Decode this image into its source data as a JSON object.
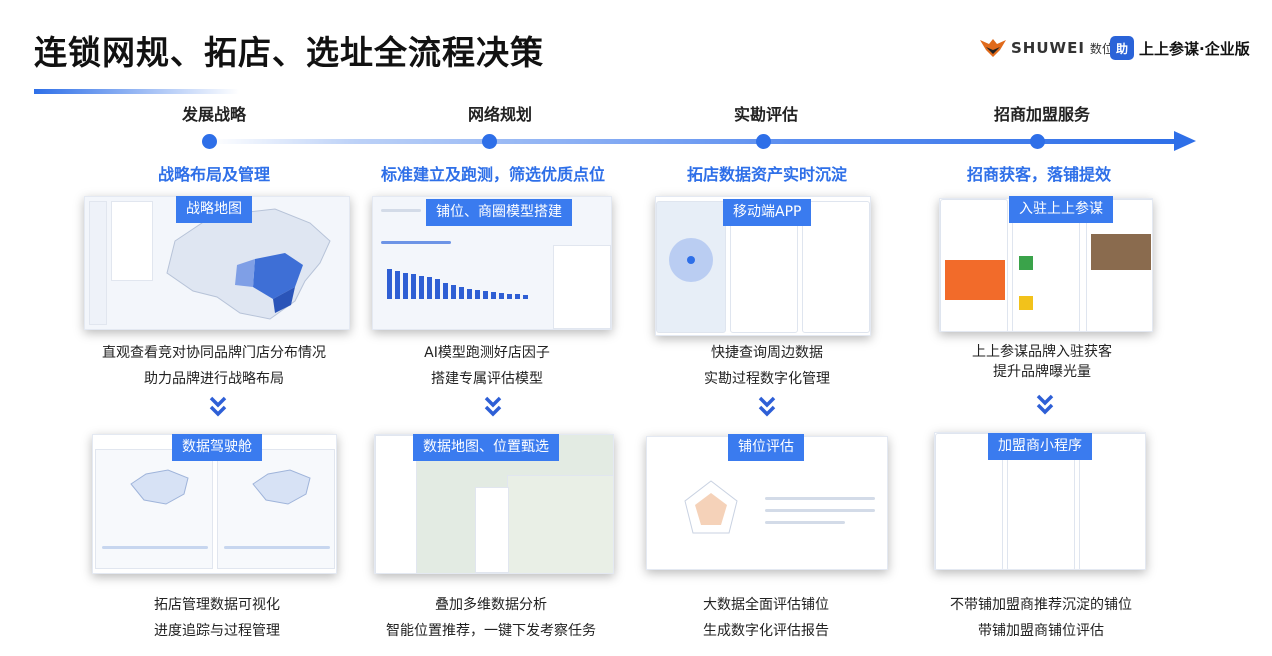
{
  "page": {
    "title": "连锁网规、拓店、选址全流程决策"
  },
  "logos": {
    "shuwei": {
      "mark": "SHUWEI",
      "cn": "数位"
    },
    "app": {
      "badge": "助",
      "name": "上上参谋·企业版"
    }
  },
  "columns": [
    {
      "stage": "发展战略",
      "subtitle": "战略布局及管理",
      "top": {
        "tag": "战略地图",
        "desc": [
          "直观查看竞对协同品牌门店分布情况",
          "助力品牌进行战略布局"
        ]
      },
      "bottom": {
        "tag": "数据驾驶舱",
        "desc": [
          "拓店管理数据可视化",
          "进度追踪与过程管理"
        ]
      }
    },
    {
      "stage": "网络规划",
      "subtitle": "标准建立及跑测，筛选优质点位",
      "top": {
        "tag": "铺位、商圈模型搭建",
        "desc": [
          "AI模型跑测好店因子",
          "搭建专属评估模型"
        ]
      },
      "bottom": {
        "tag": "数据地图、位置甄选",
        "desc": [
          "叠加多维数据分析",
          "智能位置推荐，一键下发考察任务"
        ]
      }
    },
    {
      "stage": "实勘评估",
      "subtitle": "拓店数据资产实时沉淀",
      "top": {
        "tag": "移动端APP",
        "desc": [
          "快捷查询周边数据",
          "实勘过程数字化管理"
        ]
      },
      "bottom": {
        "tag": "铺位评估",
        "desc": [
          "大数据全面评估铺位",
          "生成数字化评估报告"
        ]
      }
    },
    {
      "stage": "招商加盟服务",
      "subtitle": "招商获客，落铺提效",
      "top": {
        "tag": "入驻上上参谋",
        "desc": [
          "上上参谋品牌入驻获客",
          "提升品牌曝光量"
        ]
      },
      "bottom": {
        "tag": "加盟商小程序",
        "desc": [
          "不带铺加盟商推荐沉淀的铺位",
          "带铺加盟商铺位评估"
        ]
      }
    }
  ],
  "colors": {
    "accent": "#2e6fe8",
    "tag_bg": "#3a7bef",
    "chevron": "#2e5fd6"
  },
  "icons": {
    "chevron": "double-chevron-down-icon",
    "timeline": "arrow-right-icon"
  }
}
